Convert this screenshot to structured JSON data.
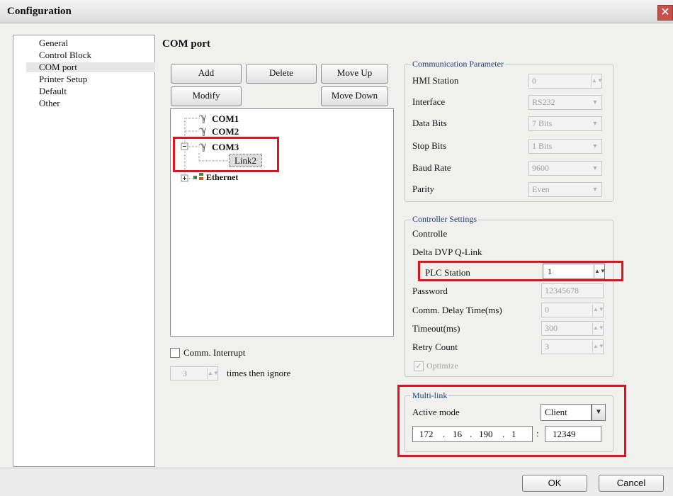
{
  "window": {
    "title": "Configuration"
  },
  "nav": {
    "items": [
      "General",
      "Control Block",
      "COM port",
      "Printer Setup",
      "Default",
      "Other"
    ]
  },
  "section": {
    "title": "COM port"
  },
  "toolbar": {
    "add": "Add",
    "delete": "Delete",
    "move_up": "Move Up",
    "modify": "Modify",
    "move_down": "Move Down"
  },
  "tree": {
    "com1": "COM1",
    "com2": "COM2",
    "com3": "COM3",
    "link2": "Link2",
    "ethernet": "Ethernet"
  },
  "comm_interrupt": {
    "label": "Comm. Interrupt",
    "times": "3",
    "suffix": "times then ignore"
  },
  "comm_param": {
    "legend": "Communication Parameter",
    "hmi_station_label": "HMI Station",
    "hmi_station": "0",
    "interface_label": "Interface",
    "interface": "RS232",
    "data_bits_label": "Data Bits",
    "data_bits": "7 Bits",
    "stop_bits_label": "Stop Bits",
    "stop_bits": "1 Bits",
    "baud_rate_label": "Baud Rate",
    "baud_rate": "9600",
    "parity_label": "Parity",
    "parity": "Even"
  },
  "controller": {
    "legend": "Controller Settings",
    "controller_label": "Controlle",
    "controller_name": "Delta DVP Q-Link",
    "plc_station_label": "PLC Station",
    "plc_station": "1",
    "password_label": "Password",
    "password": "12345678",
    "delay_label": "Comm. Delay Time(ms)",
    "delay": "0",
    "timeout_label": "Timeout(ms)",
    "timeout": "300",
    "retry_label": "Retry Count",
    "retry": "3",
    "optimize_label": "Optimize"
  },
  "multilink": {
    "legend": "Multi-link",
    "active_mode_label": "Active mode",
    "active_mode": "Client",
    "ip": [
      "172",
      "16",
      "190",
      "1"
    ],
    "port": "12349"
  },
  "dialog": {
    "ok": "OK",
    "cancel": "Cancel"
  },
  "colors": {
    "highlight": "#e0131c",
    "legend_text": "#23407a"
  }
}
